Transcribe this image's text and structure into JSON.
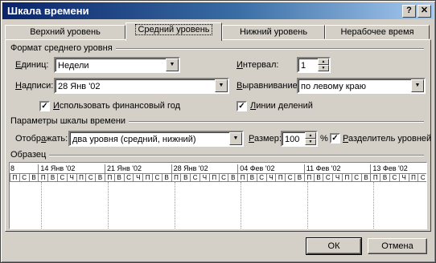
{
  "window": {
    "title": "Шкала времени",
    "help_glyph": "?",
    "close_glyph": "✕"
  },
  "tabs": [
    {
      "label": "Верхний уровень",
      "active": false
    },
    {
      "label": "Средний уровень",
      "active": true
    },
    {
      "label": "Нижний уровень",
      "active": false
    },
    {
      "label": "Нерабочее время",
      "active": false
    }
  ],
  "format_group": {
    "label": "Формат среднего уровня",
    "units_label_pre": "",
    "units_label_u": "Е",
    "units_label_post": "диниц:",
    "units_value": "Недели",
    "interval_label_pre": "",
    "interval_label_u": "И",
    "interval_label_post": "нтервал:",
    "interval_value": "1",
    "captions_label_pre": "",
    "captions_label_u": "Н",
    "captions_label_post": "адписи:",
    "captions_value": "28 Янв '02",
    "align_label_pre": "",
    "align_label_u": "В",
    "align_label_post": "ыравнивание:",
    "align_value": "по левому краю",
    "fiscal_pre": "",
    "fiscal_u": "И",
    "fiscal_post": "спользовать финансовый год",
    "fiscal_checked": true,
    "ticks_pre": "",
    "ticks_u": "Л",
    "ticks_post": "инии делений",
    "ticks_checked": true
  },
  "scale_group": {
    "label": "Параметры шкалы времени",
    "show_label_pre": "Отобр",
    "show_label_u": "а",
    "show_label_post": "жать:",
    "show_value": "два уровня (средний, нижний)",
    "size_label_pre": "",
    "size_label_u": "Р",
    "size_label_post": "азмер:",
    "size_value": "100",
    "percent": "%",
    "separator_pre": "",
    "separator_u": "Р",
    "separator_post": "азделитель уровней",
    "separator_checked": true
  },
  "sample": {
    "label": "Образец",
    "first_stub": "8",
    "major": [
      "14 Янв '02",
      "21 Янв '02",
      "28 Янв '02",
      "04 Фев '02",
      "11 Фев '02",
      "13 Фев '02"
    ],
    "lead_days": [
      "П",
      "С",
      "В"
    ],
    "week_days": [
      "П",
      "В",
      "С",
      "Ч",
      "П",
      "С",
      "В"
    ]
  },
  "buttons": {
    "ok": "ОК",
    "cancel": "Отмена"
  },
  "check_glyph": "✓",
  "arrow_down": "▼",
  "arrow_up": "▲"
}
